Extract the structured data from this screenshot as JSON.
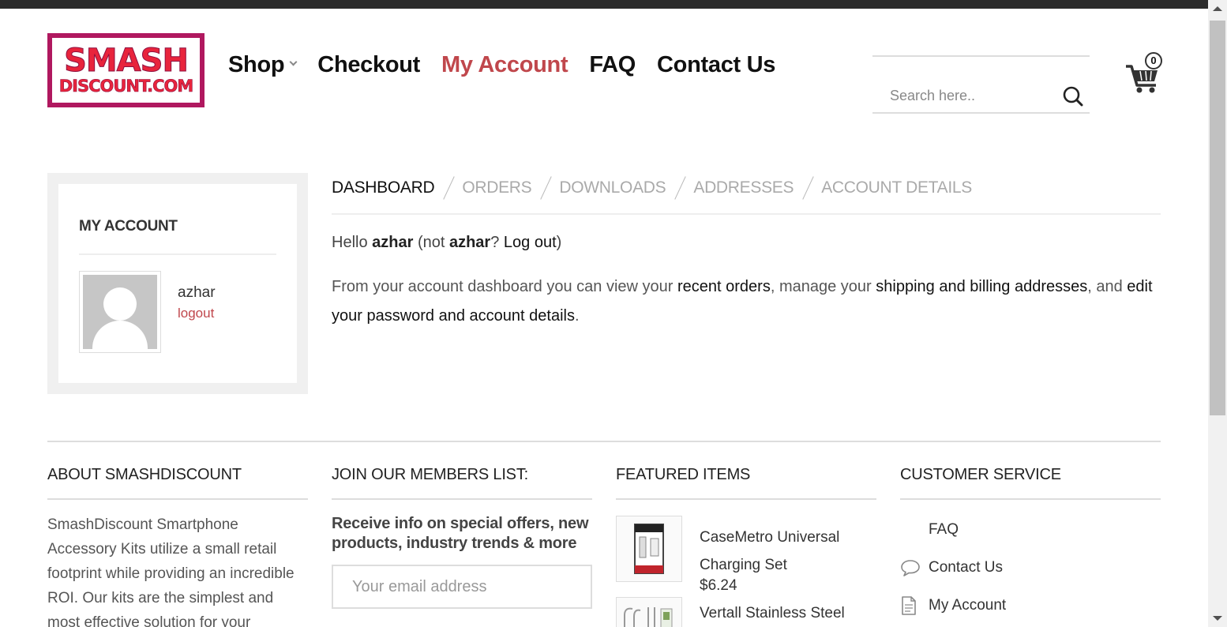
{
  "logo": {
    "line1": "SMASH",
    "line2": "DISCOUNT.COM"
  },
  "nav": {
    "shop": "Shop",
    "checkout": "Checkout",
    "my_account": "My Account",
    "faq": "FAQ",
    "contact": "Contact Us"
  },
  "search": {
    "placeholder": "Search here.."
  },
  "cart": {
    "count": "0"
  },
  "sidebar": {
    "title": "MY ACCOUNT",
    "username": "azhar",
    "logout": "logout"
  },
  "tabs": [
    "DASHBOARD",
    "ORDERS",
    "DOWNLOADS",
    "ADDRESSES",
    "ACCOUNT DETAILS"
  ],
  "dashboard": {
    "hello_prefix": "Hello ",
    "hello_user": "azhar",
    "hello_mid": " (not ",
    "hello_user2": "azhar",
    "hello_q": "? ",
    "logout_link": "Log out",
    "hello_end": ")",
    "desc_1": "From your account dashboard you can view your ",
    "recent_orders": "recent orders",
    "desc_2": ", manage your ",
    "addresses_link": "shipping and billing addresses",
    "desc_3": ", and ",
    "account_link": "edit your password and account details",
    "desc_4": "."
  },
  "footer": {
    "about": {
      "title": "ABOUT SMASHDISCOUNT",
      "text": "SmashDiscount Smartphone Accessory Kits utilize a small retail footprint while providing an incredible ROI. Our kits are the simplest and most effective solution for your"
    },
    "members": {
      "title": "JOIN OUR MEMBERS LIST:",
      "subtitle": "Receive info on special offers, new products, industry trends & more",
      "email_placeholder": "Your email address"
    },
    "featured": {
      "title": "FEATURED ITEMS",
      "items": [
        {
          "name": "CaseMetro Universal Charging Set",
          "price": "$6.24"
        },
        {
          "name": "Vertall Stainless Steel"
        }
      ]
    },
    "service": {
      "title": "CUSTOMER SERVICE",
      "links": [
        {
          "label": "FAQ",
          "icon": "none"
        },
        {
          "label": "Contact Us",
          "icon": "speech-bubble-icon"
        },
        {
          "label": "My Account",
          "icon": "document-icon"
        }
      ]
    }
  },
  "colors": {
    "accent": "#c0474c",
    "logo_border": "#b0185f",
    "logo_text": "#e8243c"
  }
}
